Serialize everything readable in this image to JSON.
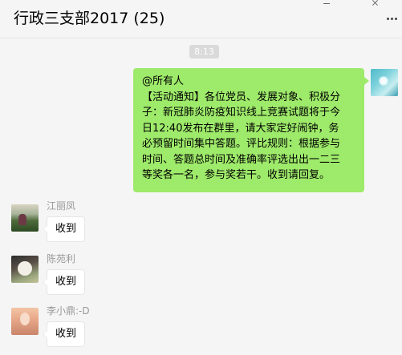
{
  "header": {
    "title": "行政三支部2017 (25)"
  },
  "chat": {
    "time": "8:13",
    "self_message": {
      "lines": [
        "@所有人",
        "【活动通知】各位党员、发展对象、积极分",
        "子：新冠肺炎防疫知识线上竞赛试题将于今",
        "日12:40发布在群里，请大家定好闹钟，务",
        "必预留时间集中答题。评比规则：根据参与",
        "时间、答题总时间及准确率评选出出一二三",
        "等奖各一名，参与奖若干。收到请回复。"
      ]
    },
    "replies": [
      {
        "sender": "江丽凤",
        "text": "收到"
      },
      {
        "sender": "陈苑利",
        "text": "收到"
      },
      {
        "sender": "李小鼎:-D",
        "text": "收到"
      }
    ]
  },
  "colors": {
    "self_bubble": "#9eea6a",
    "background": "#f5f5f5",
    "other_bubble": "#ffffff"
  },
  "icons": [
    "minimize-icon",
    "close-icon",
    "more-options-icon",
    "avatar"
  ]
}
